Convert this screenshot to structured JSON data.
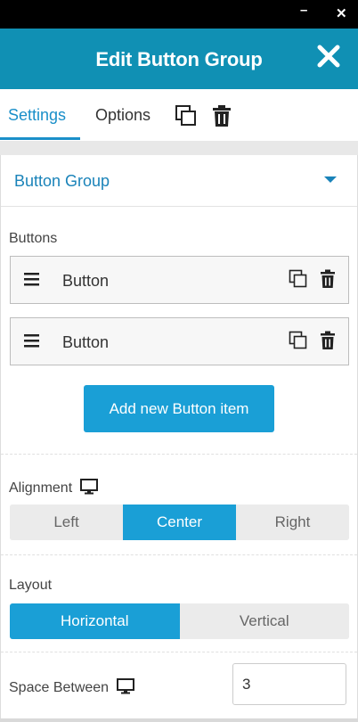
{
  "window": {
    "minimize_glyph": "–",
    "close_glyph": "✕"
  },
  "header": {
    "title": "Edit Button Group",
    "close_icon": "close-icon"
  },
  "tabs": {
    "settings": "Settings",
    "options": "Options",
    "copy_icon": "copy-icon",
    "trash_icon": "trash-icon"
  },
  "section": {
    "title": "Button Group"
  },
  "buttons": {
    "label": "Buttons",
    "items": [
      {
        "label": "Button"
      },
      {
        "label": "Button"
      }
    ],
    "add_label": "Add new Button item"
  },
  "alignment": {
    "label": "Alignment",
    "options": [
      "Left",
      "Center",
      "Right"
    ],
    "selected": "Center"
  },
  "layout": {
    "label": "Layout",
    "options": [
      "Horizontal",
      "Vertical"
    ],
    "selected": "Horizontal"
  },
  "space_between": {
    "label": "Space Between",
    "value": "3"
  },
  "colors": {
    "header": "#1090b4",
    "accent": "#1a9fd6",
    "tab_active": "#1a8fc9"
  }
}
